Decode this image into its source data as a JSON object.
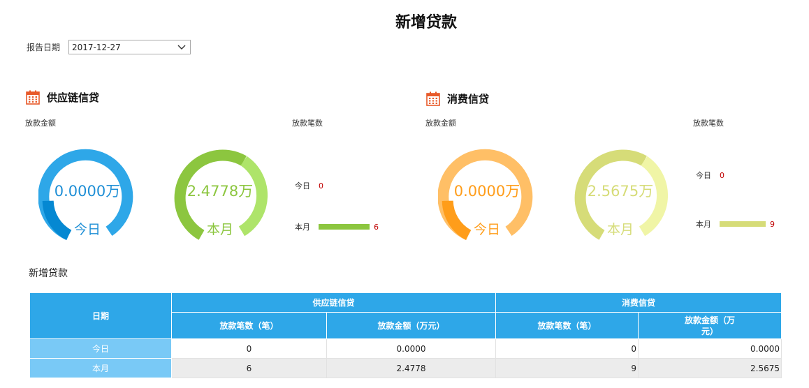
{
  "title": "新增贷款",
  "report_date": {
    "label": "报告日期",
    "value": "2017-12-27"
  },
  "sections": {
    "supply_chain": {
      "title": "供应链信贷",
      "amount_label": "放款金额",
      "count_label": "放款笔数",
      "today_donut": {
        "value": "0.0000万",
        "caption": "今日",
        "fraction": 0.0
      },
      "month_donut": {
        "value": "2.4778万",
        "caption": "本月",
        "fraction": 1.0
      },
      "counts": [
        {
          "label": "今日",
          "value": "0",
          "amount": 0
        },
        {
          "label": "本月",
          "value": "6",
          "amount": 6
        }
      ],
      "colors": {
        "today_main": "#2ea7e8",
        "today_dark": "#0588d2",
        "month_main": "#8cc63f",
        "month_light": "#aee46a",
        "bar": "#8cc63f"
      }
    },
    "consumer": {
      "title": "消费信贷",
      "amount_label": "放款金额",
      "count_label": "放款笔数",
      "today_donut": {
        "value": "0.0000万",
        "caption": "今日",
        "fraction": 0.0
      },
      "month_donut": {
        "value": "2.5675万",
        "caption": "本月",
        "fraction": 1.0
      },
      "counts": [
        {
          "label": "今日",
          "value": "0",
          "amount": 0
        },
        {
          "label": "本月",
          "value": "9",
          "amount": 9
        }
      ],
      "colors": {
        "today_main": "#ffbf66",
        "today_dark": "#ff9d1a",
        "month_main": "#d6dc78",
        "month_light": "#f0f5a6",
        "bar": "#d6dc78"
      }
    }
  },
  "table": {
    "title": "新增贷款",
    "date_header": "日期",
    "group_headers": [
      "供应链信贷",
      "消费信贷"
    ],
    "sub_headers": [
      "放款笔数（笔）",
      "放款金额（万元）",
      "放款笔数（笔）",
      "放款金额（万\n元）"
    ],
    "rows": [
      {
        "label": "今日",
        "cells": [
          "0",
          "0.0000",
          "0",
          "0.0000"
        ]
      },
      {
        "label": "本月",
        "cells": [
          "6",
          "2.4778",
          "9",
          "2.5675"
        ]
      }
    ]
  }
}
